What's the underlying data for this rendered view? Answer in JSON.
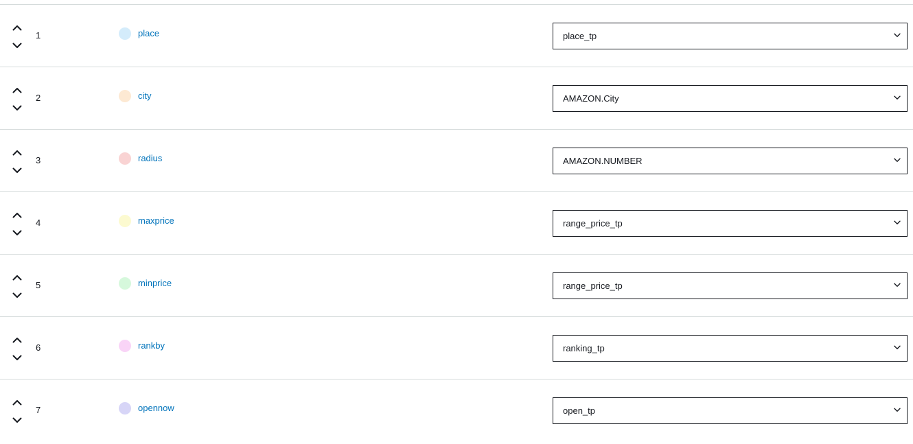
{
  "slots": [
    {
      "order": "1",
      "name": "place",
      "type": "place_tp",
      "color": "#d4ecfb"
    },
    {
      "order": "2",
      "name": "city",
      "type": "AMAZON.City",
      "color": "#fde9d3"
    },
    {
      "order": "3",
      "name": "radius",
      "type": "AMAZON.NUMBER",
      "color": "#f9d3d3"
    },
    {
      "order": "4",
      "name": "maxprice",
      "type": "range_price_tp",
      "color": "#fcfad0"
    },
    {
      "order": "5",
      "name": "minprice",
      "type": "range_price_tp",
      "color": "#d6f8dc"
    },
    {
      "order": "6",
      "name": "rankby",
      "type": "ranking_tp",
      "color": "#f9d4f7"
    },
    {
      "order": "7",
      "name": "opennow",
      "type": "open_tp",
      "color": "#d7d5f7"
    }
  ],
  "icons": {
    "move_up": "chevron-up-icon",
    "move_down": "chevron-down-icon",
    "select_caret": "caret-down-icon"
  }
}
